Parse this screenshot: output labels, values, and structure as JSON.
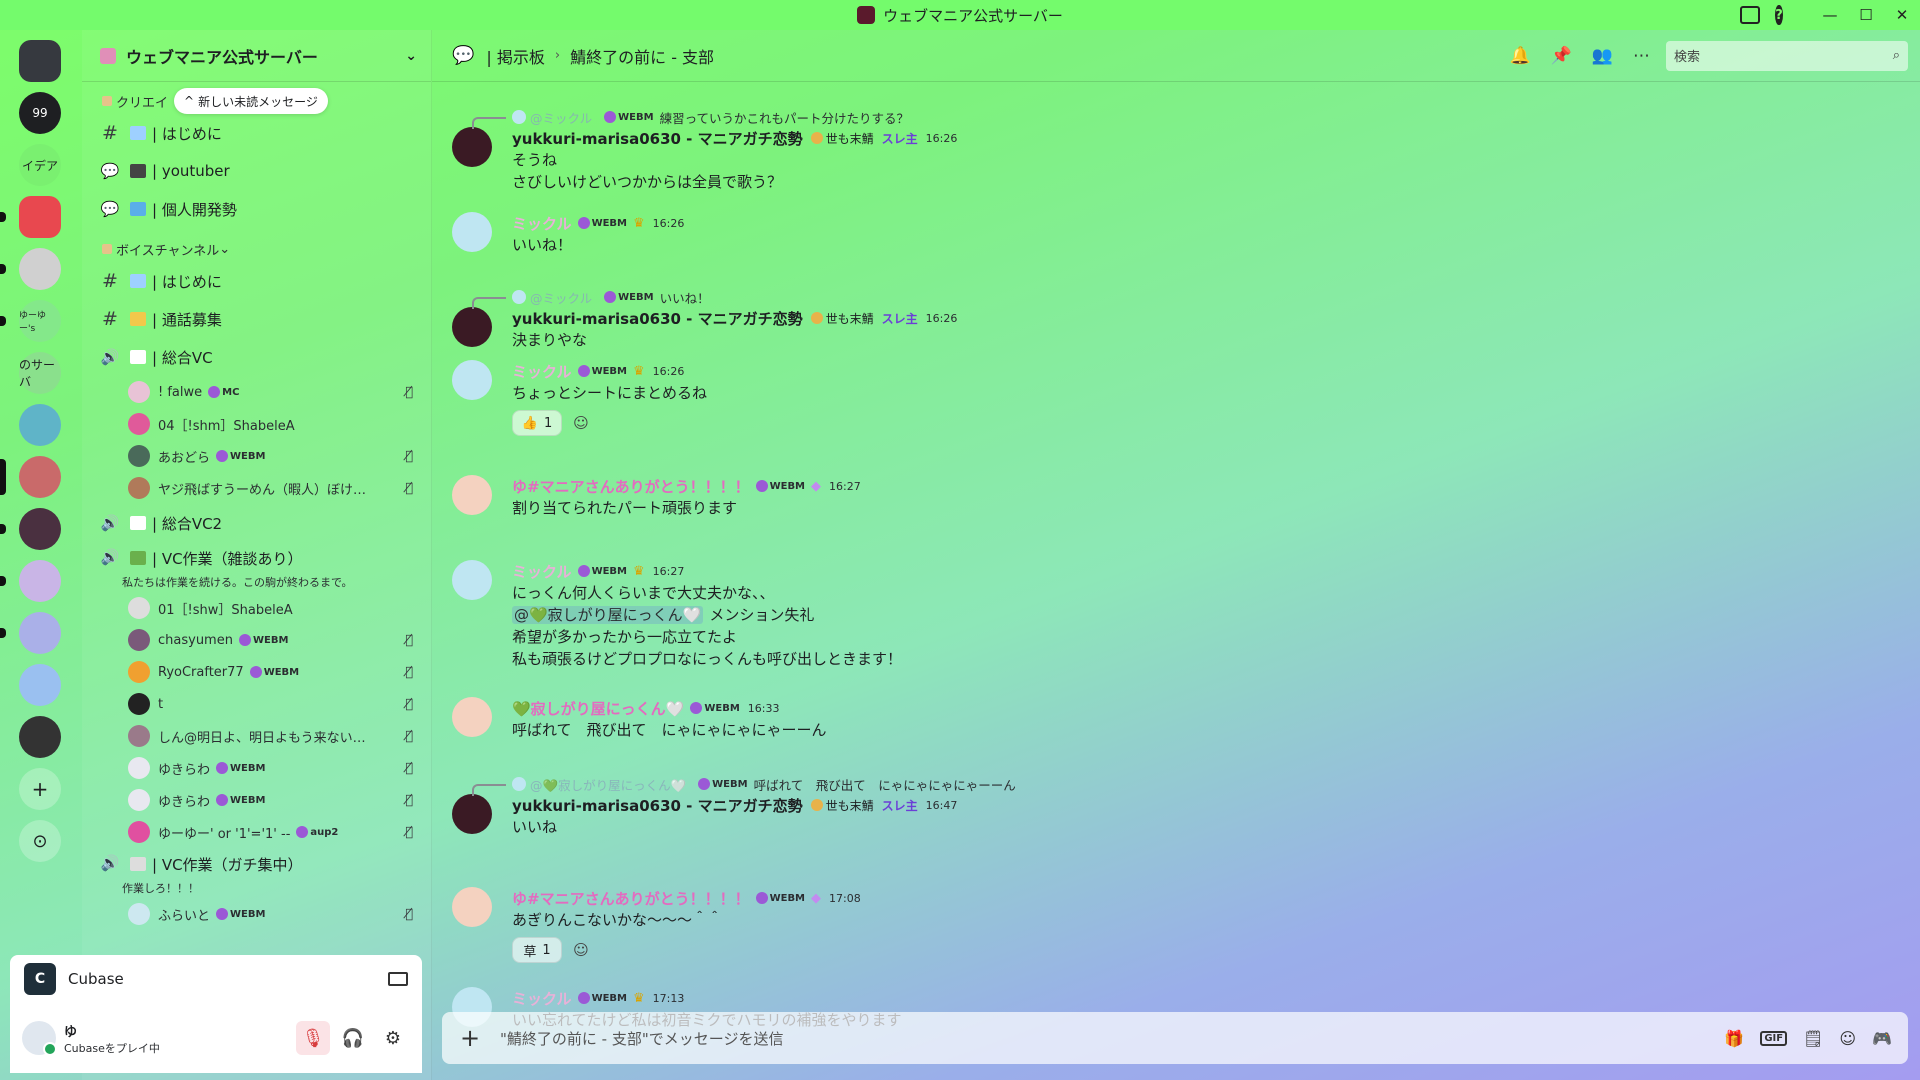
{
  "window": {
    "title": "ウェブマニア公式サーバー",
    "controls": [
      "inbox-icon",
      "help-icon",
      "minimize",
      "maximize",
      "close"
    ]
  },
  "rail": {
    "servers": [
      {
        "label": "",
        "color": "#36393f",
        "icon": "discord-home"
      },
      {
        "label": "99",
        "color": "#1e1f22",
        "icon": "quote"
      },
      {
        "label": "イデア",
        "color": "#7af070",
        "icon": ""
      },
      {
        "label": "",
        "color": "#e8484f",
        "icon": "discord-red"
      },
      {
        "label": "",
        "color": "#d0d0d0",
        "icon": "avatar"
      },
      {
        "label": "ゆーゆー's",
        "color": "#84e88a",
        "icon": ""
      },
      {
        "label": "のサーバ",
        "color": "#8ae08c",
        "icon": ""
      },
      {
        "label": "",
        "color": "#5fb4c8",
        "icon": "avatar"
      },
      {
        "label": "",
        "color": "#c96a6a",
        "icon": "avatar"
      },
      {
        "label": "",
        "color": "#4a3040",
        "icon": "avatar"
      },
      {
        "label": "",
        "color": "#c9b5e6",
        "icon": "avatar"
      },
      {
        "label": "",
        "color": "#aab0e8",
        "icon": "avatar"
      },
      {
        "label": "",
        "color": "#9ac0f0",
        "icon": "avatar"
      },
      {
        "label": "",
        "color": "#333333",
        "icon": "avatar"
      }
    ],
    "add_label": "+",
    "explore_label": "⊙"
  },
  "sidebar": {
    "server_name": "ウェブマニア公式サーバー",
    "new_unread": "新しい未読メッセージ",
    "category_top": "クリエイ",
    "channels_top": [
      {
        "type": "text",
        "name": "| はじめに",
        "emo_color": "#9ed0ff"
      },
      {
        "type": "forum",
        "name": "| youtuber",
        "emo_color": "#444"
      },
      {
        "type": "forum",
        "name": "| 個人開発勢",
        "emo_color": "#5aaee8"
      }
    ],
    "voice_category": "ボイスチャンネル",
    "voice_channels": [
      {
        "type": "text",
        "name": "| はじめに",
        "emo_color": "#9ed0ff"
      },
      {
        "type": "text",
        "name": "| 通話募集",
        "emo_color": "#f2c84b"
      },
      {
        "type": "voice",
        "name": "| 総合VC",
        "emo_color": "#ffffff"
      }
    ],
    "vc1_users": [
      {
        "name": "! falwe",
        "tag": "MC",
        "av": "#e8c3d6",
        "muted": true
      },
      {
        "name": "04［!shm］ShabeleA",
        "tag": "",
        "av": "#e05a9a",
        "muted": false
      },
      {
        "name": "あおどら",
        "tag": "WEBM",
        "av": "#4a6a5a",
        "muted": true
      },
      {
        "name": "ヤジ飛ばすうーめん（暇人）ぼけ…",
        "tag": "",
        "av": "#b07a5a",
        "muted": true
      }
    ],
    "vc2": {
      "name": "| 総合VC2"
    },
    "vc3": {
      "name": "| VC作業（雑談あり）",
      "desc": "私たちは作業を続ける。この駒が終わるまで。"
    },
    "vc3_users": [
      {
        "name": "01［!shw］ShabeleA",
        "tag": "",
        "av": "#dddddd",
        "muted": false
      },
      {
        "name": "chasyumen",
        "tag": "WEBM",
        "av": "#7a5a7a",
        "muted": true
      },
      {
        "name": "RyoCrafter77",
        "tag": "WEBM",
        "av": "#f0a030",
        "muted": true
      },
      {
        "name": "t",
        "tag": "",
        "av": "#222222",
        "muted": true
      },
      {
        "name": "しん@明日よ、明日よもう来ない…",
        "tag": "",
        "av": "#9a7a8a",
        "muted": true
      },
      {
        "name": "ゆきらわ",
        "tag": "WEBM",
        "av": "#e8e8f0",
        "muted": true
      },
      {
        "name": "ゆきらわ",
        "tag": "WEBM",
        "av": "#e8e8f0",
        "muted": true
      },
      {
        "name": "ゆーゆー' or '1'='1' --",
        "tag": "aup2",
        "av": "#e050a0",
        "muted": true
      }
    ],
    "vc4": {
      "name": "| VC作業（ガチ集中）",
      "desc": "作業しろ！！！"
    },
    "vc4_users": [
      {
        "name": "ふらいと",
        "tag": "WEBM",
        "av": "#cde8f0",
        "muted": true
      }
    ]
  },
  "activity": {
    "app": "Cubase"
  },
  "user": {
    "name": "ゆ",
    "status": "Cubaseをプレイ中"
  },
  "chat": {
    "breadcrumb_parent": "| 掲示板",
    "breadcrumb_thread": "鯖終了の前に - 支部",
    "search_placeholder": "検索",
    "composer_placeholder": "\"鯖終了の前に - 支部\"でメッセージを送信"
  },
  "messages": [
    {
      "reply": {
        "name": "@ミックル",
        "tag": "WEBM",
        "text": "練習っていうかこれもパート分けたりする？"
      },
      "author": "yukkuri-marisa0630 - マニアガチ恋勢",
      "style": "dark",
      "badge": "世も末鯖",
      "role": "スレ主",
      "time": "16:26",
      "lines": [
        "そうね",
        "さびしいけどいつかからは全員で歌う？"
      ]
    },
    {
      "author": "ミックル",
      "style": "cyan",
      "tag": "WEBM",
      "crown": true,
      "time": "16:26",
      "lines": [
        "いいね！"
      ]
    },
    {
      "reply": {
        "name": "@ミックル",
        "tag": "WEBM",
        "text": "いいね！"
      },
      "author": "yukkuri-marisa0630 - マニアガチ恋勢",
      "style": "dark",
      "badge": "世も末鯖",
      "role": "スレ主",
      "time": "16:26",
      "lines": [
        "決まりやな"
      ]
    },
    {
      "author": "ミックル",
      "style": "cyan",
      "tag": "WEBM",
      "crown": true,
      "time": "16:26",
      "lines": [
        "ちょっとシートにまとめるね"
      ],
      "reaction": {
        "emoji": "👍",
        "count": "1"
      }
    },
    {
      "author": "ゆ#マニアさんありがとう！！！！",
      "style": "pink",
      "tag": "WEBM",
      "time": "16:27",
      "lines": [
        "割り当てられたパート頑張ります"
      ]
    },
    {
      "author": "ミックル",
      "style": "cyan",
      "tag": "WEBM",
      "crown": true,
      "time": "16:27",
      "lines": [
        "にっくん何人くらいまで大丈夫かな、、"
      ],
      "mention": "@💚寂しがり屋にっくん🤍",
      "mention_suffix": "メンション失礼",
      "lines2": [
        "希望が多かったから一応立てたよ",
        "私も頑張るけどプロプロなにっくんも呼び出しときます！"
      ]
    },
    {
      "author": "💚寂しがり屋にっくん🤍",
      "style": "pink",
      "tag": "WEBM",
      "time": "16:33",
      "lines": [
        "呼ばれて　飛び出て　にゃにゃにゃにゃーーん"
      ]
    },
    {
      "reply": {
        "name": "@💚寂しがり屋にっくん🤍",
        "tag": "WEBM",
        "text": "呼ばれて　飛び出て　にゃにゃにゃにゃーーん"
      },
      "author": "yukkuri-marisa0630 - マニアガチ恋勢",
      "style": "dark",
      "badge": "世も末鯖",
      "role": "スレ主",
      "time": "16:47",
      "lines": [
        "いいね"
      ]
    },
    {
      "author": "ゆ#マニアさんありがとう！！！！",
      "style": "pink",
      "tag": "WEBM",
      "time": "17:08",
      "lines": [
        "あぎりんこないかな〜〜〜＾＾"
      ],
      "reaction": {
        "emoji": "草",
        "count": "1"
      }
    },
    {
      "author": "ミックル",
      "style": "cyan",
      "tag": "WEBM",
      "crown": true,
      "time": "17:13",
      "lines": [
        "いい忘れてたけど私は初音ミクでハモリの補強をやります"
      ]
    }
  ]
}
